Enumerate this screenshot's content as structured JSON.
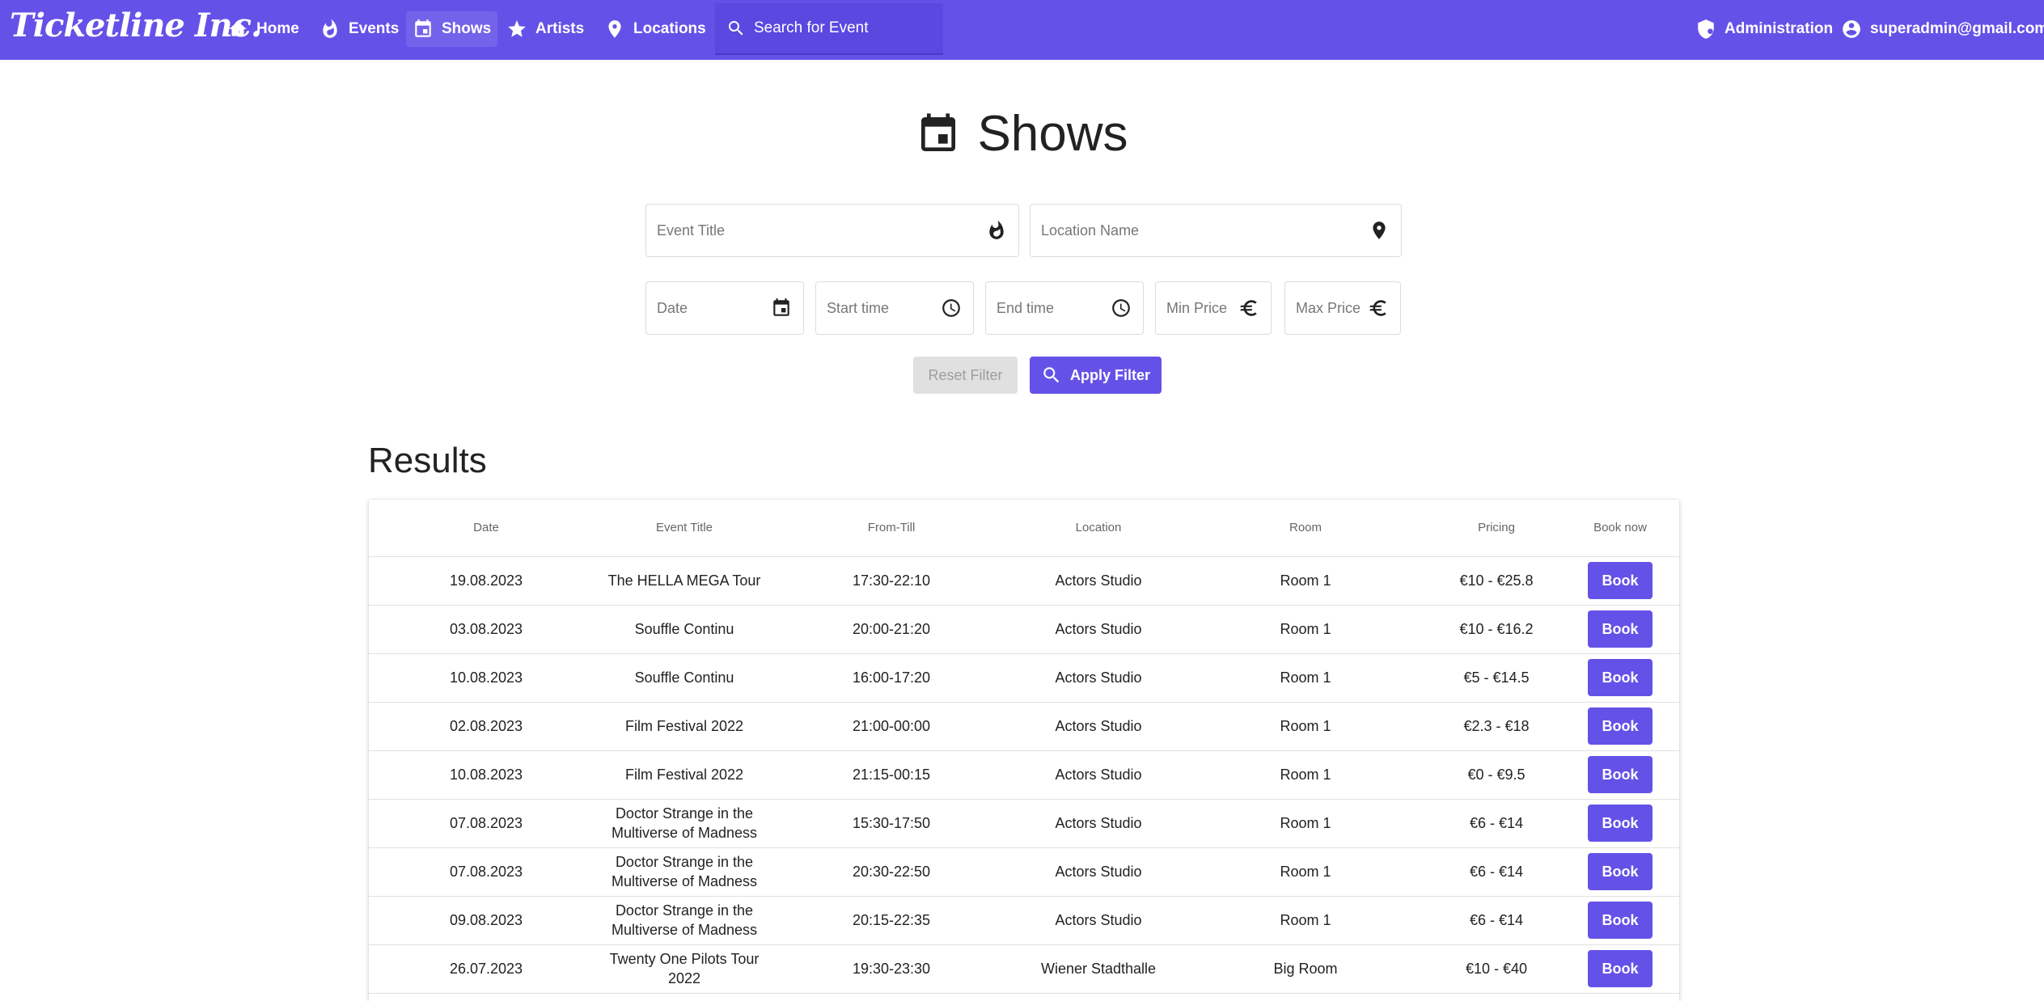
{
  "navbar": {
    "brand": "Ticketline Inc.",
    "items": [
      {
        "label": "Home",
        "icon": "home-icon"
      },
      {
        "label": "Events",
        "icon": "flame-icon"
      },
      {
        "label": "Shows",
        "icon": "calendar-icon"
      },
      {
        "label": "Artists",
        "icon": "star-icon"
      },
      {
        "label": "Locations",
        "icon": "location-pin-icon"
      }
    ],
    "search_placeholder": "Search for Event",
    "admin_label": "Administration",
    "user_label": "superadmin@gmail.com",
    "accent_color": "#6452e8"
  },
  "page": {
    "title": "Shows"
  },
  "filters": {
    "event_title": "Event Title",
    "location_name": "Location Name",
    "date": "Date",
    "start_time": "Start time",
    "end_time": "End time",
    "min_price": "Min Price",
    "max_price": "Max Price",
    "reset_label": "Reset Filter",
    "apply_label": "Apply Filter"
  },
  "results": {
    "title": "Results",
    "columns": [
      "Date",
      "Event Title",
      "From-Till",
      "Location",
      "Room",
      "Pricing",
      "Book now"
    ],
    "book_label": "Book",
    "rows": [
      {
        "date": "19.08.2023",
        "title": "The HELLA MEGA Tour",
        "time": "17:30-22:10",
        "location": "Actors Studio",
        "room": "Room 1",
        "pricing": "€10 - €25.8"
      },
      {
        "date": "03.08.2023",
        "title": "Souffle Continu",
        "time": "20:00-21:20",
        "location": "Actors Studio",
        "room": "Room 1",
        "pricing": "€10 - €16.2"
      },
      {
        "date": "10.08.2023",
        "title": "Souffle Continu",
        "time": "16:00-17:20",
        "location": "Actors Studio",
        "room": "Room 1",
        "pricing": "€5 - €14.5"
      },
      {
        "date": "02.08.2023",
        "title": "Film Festival 2022",
        "time": "21:00-00:00",
        "location": "Actors Studio",
        "room": "Room 1",
        "pricing": "€2.3 - €18"
      },
      {
        "date": "10.08.2023",
        "title": "Film Festival 2022",
        "time": "21:15-00:15",
        "location": "Actors Studio",
        "room": "Room 1",
        "pricing": "€0 - €9.5"
      },
      {
        "date": "07.08.2023",
        "title": "Doctor Strange in the Multiverse of Madness",
        "time": "15:30-17:50",
        "location": "Actors Studio",
        "room": "Room 1",
        "pricing": "€6 - €14"
      },
      {
        "date": "07.08.2023",
        "title": "Doctor Strange in the Multiverse of Madness",
        "time": "20:30-22:50",
        "location": "Actors Studio",
        "room": "Room 1",
        "pricing": "€6 - €14"
      },
      {
        "date": "09.08.2023",
        "title": "Doctor Strange in the Multiverse of Madness",
        "time": "20:15-22:35",
        "location": "Actors Studio",
        "room": "Room 1",
        "pricing": "€6 - €14"
      },
      {
        "date": "26.07.2023",
        "title": "Twenty One Pilots Tour 2022",
        "time": "19:30-23:30",
        "location": "Wiener Stadthalle",
        "room": "Big Room",
        "pricing": "€10 - €40"
      }
    ]
  }
}
